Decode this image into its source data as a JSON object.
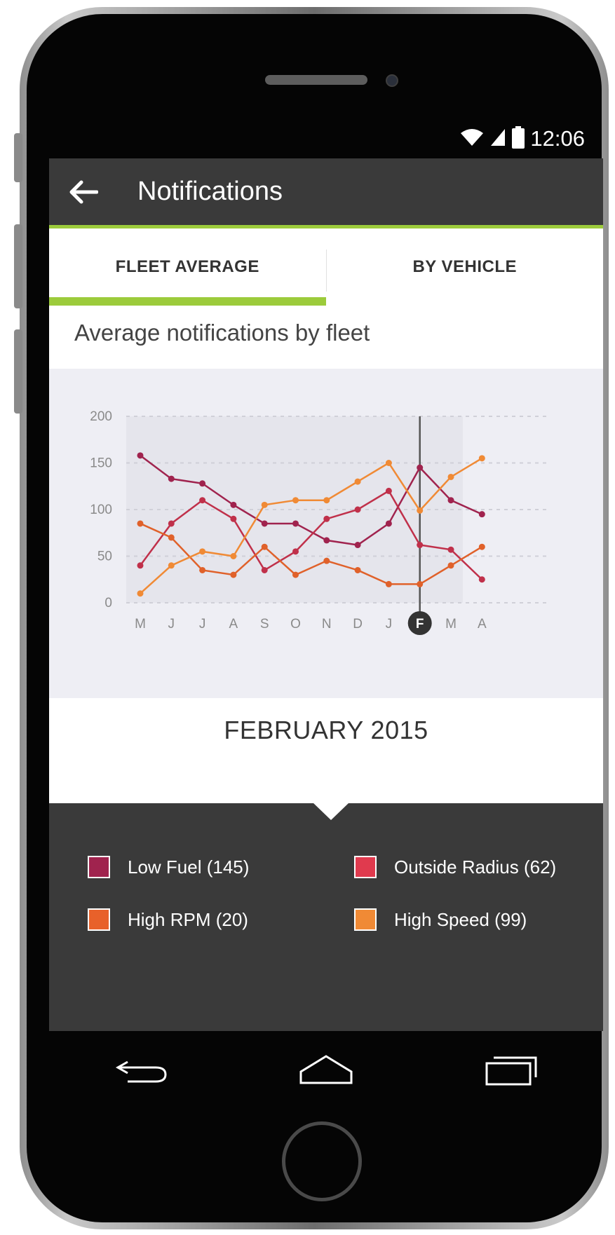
{
  "status_bar": {
    "time": "12:06",
    "icons": [
      "wifi-icon",
      "signal-icon",
      "battery-icon"
    ]
  },
  "app_bar": {
    "title": "Notifications",
    "back_icon": "arrow-left-icon"
  },
  "tabs": [
    {
      "label": "FLEET AVERAGE",
      "active": true
    },
    {
      "label": "BY VEHICLE",
      "active": false
    }
  ],
  "chart_heading": "Average notifications by fleet",
  "chart_data": {
    "type": "line",
    "categories": [
      "M",
      "J",
      "J",
      "A",
      "S",
      "O",
      "N",
      "D",
      "J",
      "F",
      "M",
      "A"
    ],
    "selected_index": 9,
    "ylim": [
      0,
      200
    ],
    "yticks": [
      0,
      50,
      100,
      150,
      200
    ],
    "grid": true,
    "series": [
      {
        "name": "Low Fuel",
        "color": "#a0234e",
        "values": [
          158,
          133,
          128,
          105,
          85,
          85,
          67,
          62,
          85,
          145,
          110,
          95
        ]
      },
      {
        "name": "Outside Radius",
        "color": "#c0304a",
        "values": [
          40,
          85,
          110,
          90,
          35,
          55,
          90,
          100,
          120,
          62,
          57,
          25
        ]
      },
      {
        "name": "High RPM",
        "color": "#e0612a",
        "values": [
          85,
          70,
          35,
          30,
          60,
          30,
          45,
          35,
          20,
          20,
          40,
          60
        ]
      },
      {
        "name": "High Speed",
        "color": "#f08a35",
        "values": [
          10,
          40,
          55,
          50,
          105,
          110,
          110,
          130,
          150,
          99,
          135,
          155
        ]
      }
    ]
  },
  "selected_month": "FEBRUARY 2015",
  "legend": [
    {
      "label": "Low Fuel (145)",
      "color": "#a0234e"
    },
    {
      "label": "Outside Radius (62)",
      "color": "#e03a4e"
    },
    {
      "label": "High RPM (20)",
      "color": "#e8612a"
    },
    {
      "label": "High Speed (99)",
      "color": "#f08a35"
    }
  ],
  "nav": {
    "icons": [
      "back-icon",
      "home-icon",
      "recents-icon"
    ]
  }
}
